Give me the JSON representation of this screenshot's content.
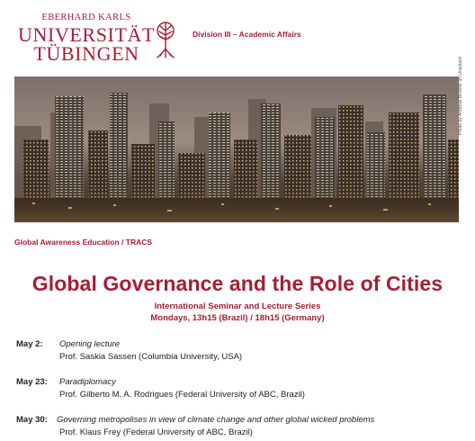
{
  "header": {
    "logo": {
      "line1": "EBERHARD KARLS",
      "line2": "UNIVERSITÄT",
      "line3": "TÜBINGEN"
    },
    "division": "Division III – Academic Affairs"
  },
  "photo": {
    "credit": "Photo by Andreas Brücker on Unsplash"
  },
  "section_label": "Global Awareness Education / TRACS",
  "title": "Global Governance and the Role of Cities",
  "subtitle": {
    "line1": "International Seminar and Lecture Series",
    "line2": "Mondays, 13h15 (Brazil) / 18h15 (Germany)"
  },
  "schedule": [
    {
      "date": "May 2:",
      "topic": "Opening lecture",
      "speaker": "Prof. Saskia Sassen (Columbia University, USA)"
    },
    {
      "date": "May 23:",
      "topic": "Paradiplomacy",
      "speaker": "Prof. Gilberto M. A. Rodrigues (Federal University of ABC, Brazil)"
    },
    {
      "date": "May 30:",
      "topic": "Governing metropolises in view of climate change and other global wicked problems",
      "speaker": "Prof. Klaus Frey (Federal University of ABC, Brazil)"
    }
  ],
  "colors": {
    "brand": "#a51e36"
  }
}
